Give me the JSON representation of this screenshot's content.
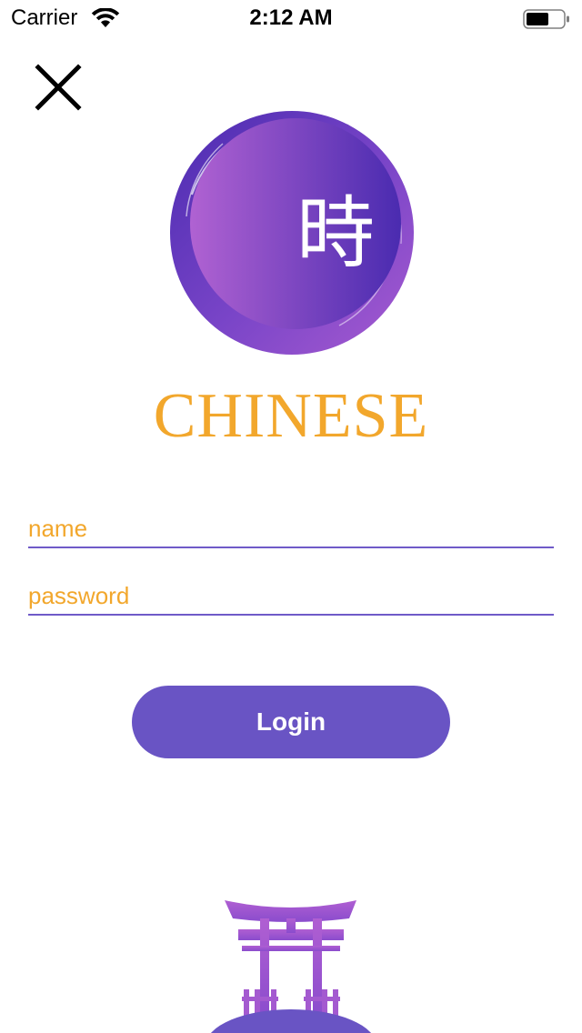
{
  "status_bar": {
    "carrier": "Carrier",
    "time": "2:12 AM",
    "wifi_icon": "wifi-icon",
    "battery_icon": "battery-icon"
  },
  "close_icon": "close-icon",
  "logo": {
    "character": "時",
    "brand_name": "CHINESE"
  },
  "form": {
    "name_placeholder": "name",
    "password_placeholder": "password",
    "login_label": "Login"
  },
  "colors": {
    "accent_orange": "#f2a72c",
    "primary_purple": "#6954c4",
    "gradient_light": "#a75bd0",
    "gradient_dark": "#4a2bb0"
  },
  "illustration": "torii-gate-icon"
}
